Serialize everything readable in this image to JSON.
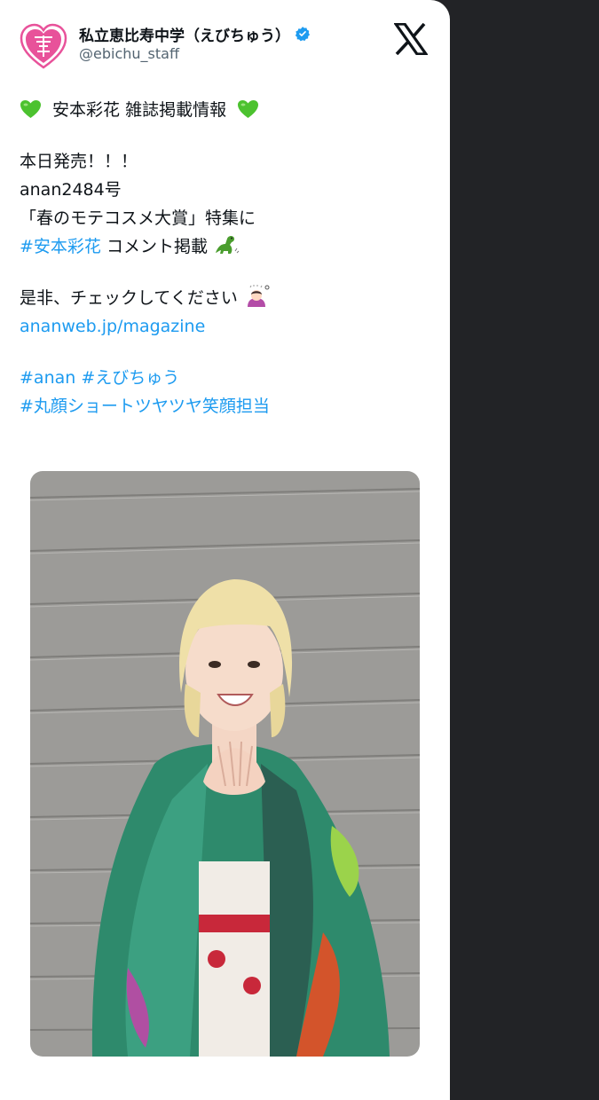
{
  "tweet": {
    "author": {
      "display_name": "私立恵比寿中学（えびちゅう）",
      "handle": "@ebichu_staff",
      "avatar_icon": "heart-logo-icon",
      "verified_icon": "verified-badge-icon"
    },
    "platform_icon": "x-logo-icon",
    "body": {
      "title": "安本彩花 雑誌掲載情報",
      "title_emoji": "green-heart-icon",
      "line1": "本日発売！！！",
      "line2": "anan2484号",
      "line3": "「春のモテコスメ大賞」特集に",
      "line4_hashtag": "#安本彩花",
      "line4_text": " コメント掲載",
      "line4_emoji": "dinosaur-icon",
      "line5_text": "是非、チェックしてください",
      "line5_emoji": "bowing-person-icon",
      "link": "ananweb.jp/magazine",
      "hashtags_line1": [
        "#anan",
        "#えびちゅう"
      ],
      "hashtags_line2": "#丸顔ショートツヤツヤ笑顔担当"
    },
    "media": {
      "type": "photo",
      "icon": "photo-blonde-woman-green-kimono"
    }
  },
  "colors": {
    "link": "#1d9bf0",
    "text": "#0f1419",
    "secondary": "#536471",
    "background": "#222326",
    "avatar_pink": "#e8529a"
  }
}
